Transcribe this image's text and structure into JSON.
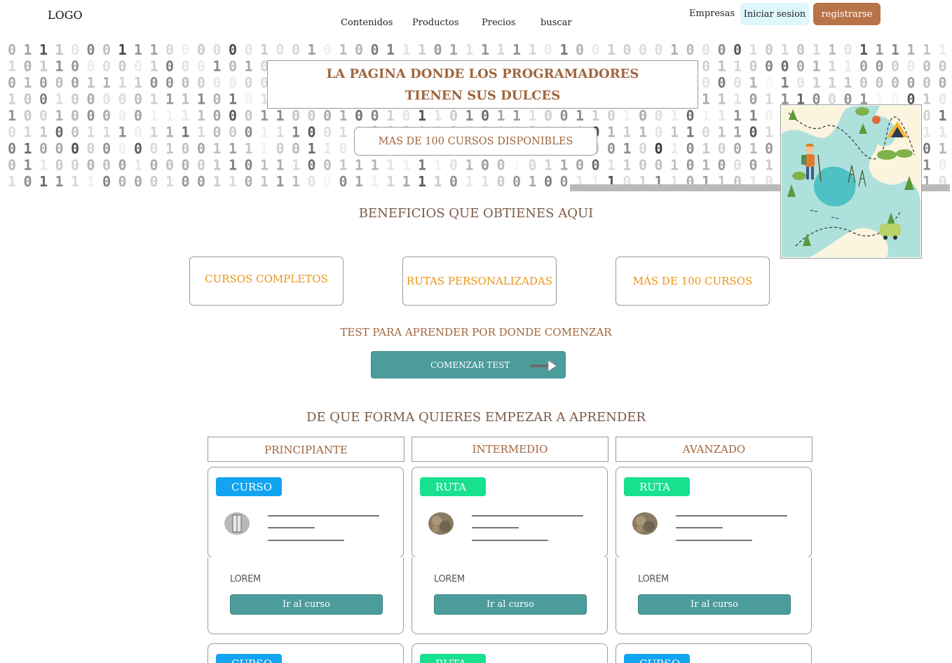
{
  "header": {
    "logo": "LOGO",
    "nav": [
      "Contenidos",
      "Productos",
      "Precios",
      "buscar"
    ],
    "empresas": "Empresas",
    "login": "Iniciar sesion",
    "register": "registrarse"
  },
  "hero": {
    "title_line1": "LA PAGINA DONDE LOS PROGRAMADORES",
    "title_line2": "TIENEN SUS DULCES",
    "subtitle": "MAS DE 100 CURSOS DISPONIBLES"
  },
  "benefits": {
    "title": "BENEFICIOS QUE OBTIENES AQUI",
    "items": [
      "CURSOS COMPLETOS",
      "RUTAS PERSONALIZADAS",
      "MÁS DE 100 CURSOS"
    ]
  },
  "test": {
    "title": "TEST PARA APRENDER POR DONDE COMENZAR",
    "button": "COMENZAR TEST"
  },
  "learn": {
    "title": "DE QUE FORMA QUIERES EMPEZAR A APRENDER",
    "levels": [
      "PRINCIPIANTE",
      "INTERMEDIO",
      "AVANZADO"
    ],
    "cards": [
      {
        "badge": "CURSO",
        "badge_color": "#12a4f1",
        "lorem": "LOREM",
        "button": "Ir al curso"
      },
      {
        "badge": "RUTA",
        "badge_color": "#17e08f",
        "lorem": "LOREM",
        "button": "Ir al curso"
      },
      {
        "badge": "RUTA",
        "badge_color": "#17e08f",
        "lorem": "LOREM",
        "button": "Ir al curso"
      }
    ],
    "cards_row2": [
      {
        "badge": "CURSO",
        "badge_color": "#12a4f1"
      },
      {
        "badge": "RUTA",
        "badge_color": "#17e08f"
      },
      {
        "badge": "CURSO",
        "badge_color": "#12a4f1"
      }
    ]
  },
  "colors": {
    "accent_brown": "#a0653c",
    "accent_orange": "#ea9516",
    "teal_button": "#4d9c9c",
    "register_button": "#b87349",
    "login_button_bg": "#ddf7fb"
  }
}
